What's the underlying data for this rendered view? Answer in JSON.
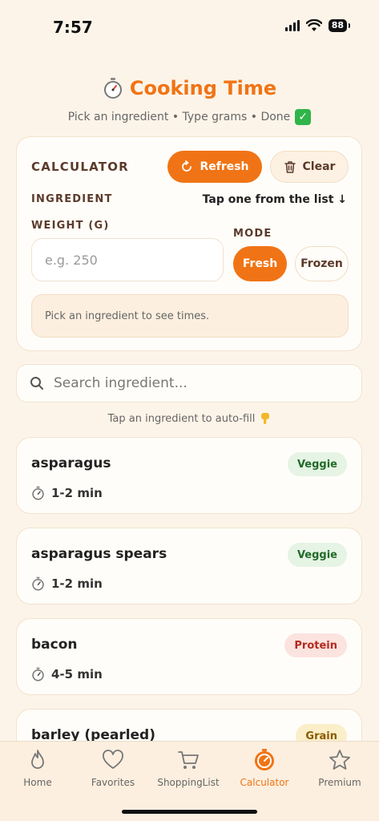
{
  "status": {
    "time": "7:57",
    "battery": "88"
  },
  "header": {
    "icon": "stopwatch-icon",
    "title": "Cooking Time",
    "subtitle": "Pick an ingredient • Type grams • Done",
    "subtitle_icon": "check-box-icon"
  },
  "calculator": {
    "label": "CALCULATOR",
    "refresh_label": "Refresh",
    "clear_label": "Clear",
    "ingredient_label": "INGREDIENT",
    "ingredient_hint": "Tap one from the list ↓",
    "weight_label": "WEIGHT (G)",
    "weight_value": "",
    "weight_placeholder": "e.g. 250",
    "mode_label": "MODE",
    "mode_fresh": "Fresh",
    "mode_frozen": "Frozen",
    "mode_selected": "Fresh",
    "times_message": "Pick an ingredient to see times."
  },
  "search": {
    "placeholder": "Search ingredient...",
    "value": "",
    "hint": "Tap an ingredient to auto-fill",
    "hint_icon": "pointing-down-hand-icon"
  },
  "ingredients": [
    {
      "name": "asparagus",
      "time": "1-2 min",
      "category": "Veggie"
    },
    {
      "name": "asparagus spears",
      "time": "1-2 min",
      "category": "Veggie"
    },
    {
      "name": "bacon",
      "time": "4-5 min",
      "category": "Protein"
    },
    {
      "name": "barley (pearled)",
      "time": "",
      "category": "Grain"
    }
  ],
  "tabs": [
    {
      "label": "Home",
      "icon": "flame-icon"
    },
    {
      "label": "Favorites",
      "icon": "heart-icon"
    },
    {
      "label": "ShoppingList",
      "icon": "cart-icon"
    },
    {
      "label": "Calculator",
      "icon": "timer-icon"
    },
    {
      "label": "Premium",
      "icon": "star-icon"
    }
  ],
  "active_tab": "Calculator",
  "colors": {
    "accent": "#f07415",
    "background": "#fdf4e9",
    "veggie": "#226b2a",
    "protein": "#b32a1e",
    "grain": "#8a5a00"
  }
}
